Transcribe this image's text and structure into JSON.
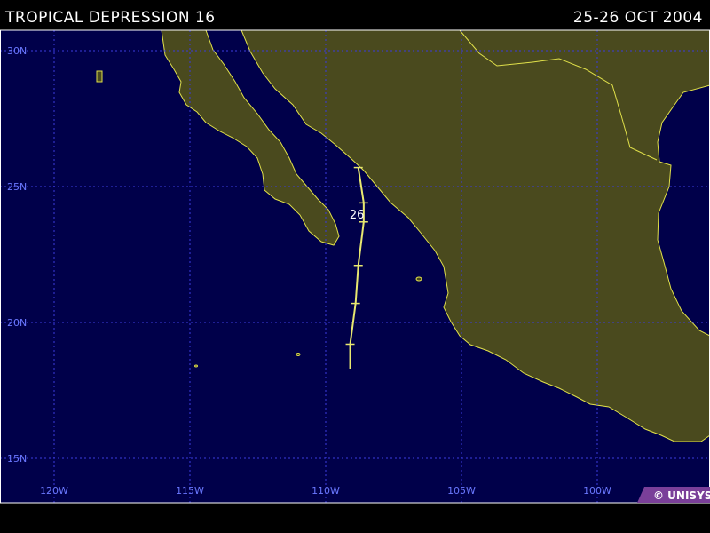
{
  "header": {
    "title": "TROPICAL DEPRESSION 16",
    "dates": "25-26 OCT 2004"
  },
  "grid": {
    "latitude_labels": [
      "30N",
      "25N",
      "20N",
      "15N"
    ],
    "longitude_labels": [
      "120W",
      "115W",
      "110W",
      "105W",
      "100W"
    ]
  },
  "track": {
    "day_label": "26",
    "points": [
      {
        "lat": 18.3,
        "lon": -109.1
      },
      {
        "lat": 19.2,
        "lon": -109.1
      },
      {
        "lat": 20.7,
        "lon": -108.9
      },
      {
        "lat": 22.1,
        "lon": -108.8
      },
      {
        "lat": 23.7,
        "lon": -108.6
      },
      {
        "lat": 24.4,
        "lon": -108.6
      },
      {
        "lat": 25.7,
        "lon": -108.8
      }
    ]
  },
  "colors": {
    "ocean": "#00004a",
    "land": "#4a4a1e",
    "coastline": "#e0e04a",
    "grid": "#3b3bdf",
    "track": "#e8e870",
    "title_text": "#ffffff",
    "axis_label": "#6a78ff",
    "copyright_bg": "#7a3f99"
  },
  "copyright": "© UNISYS"
}
